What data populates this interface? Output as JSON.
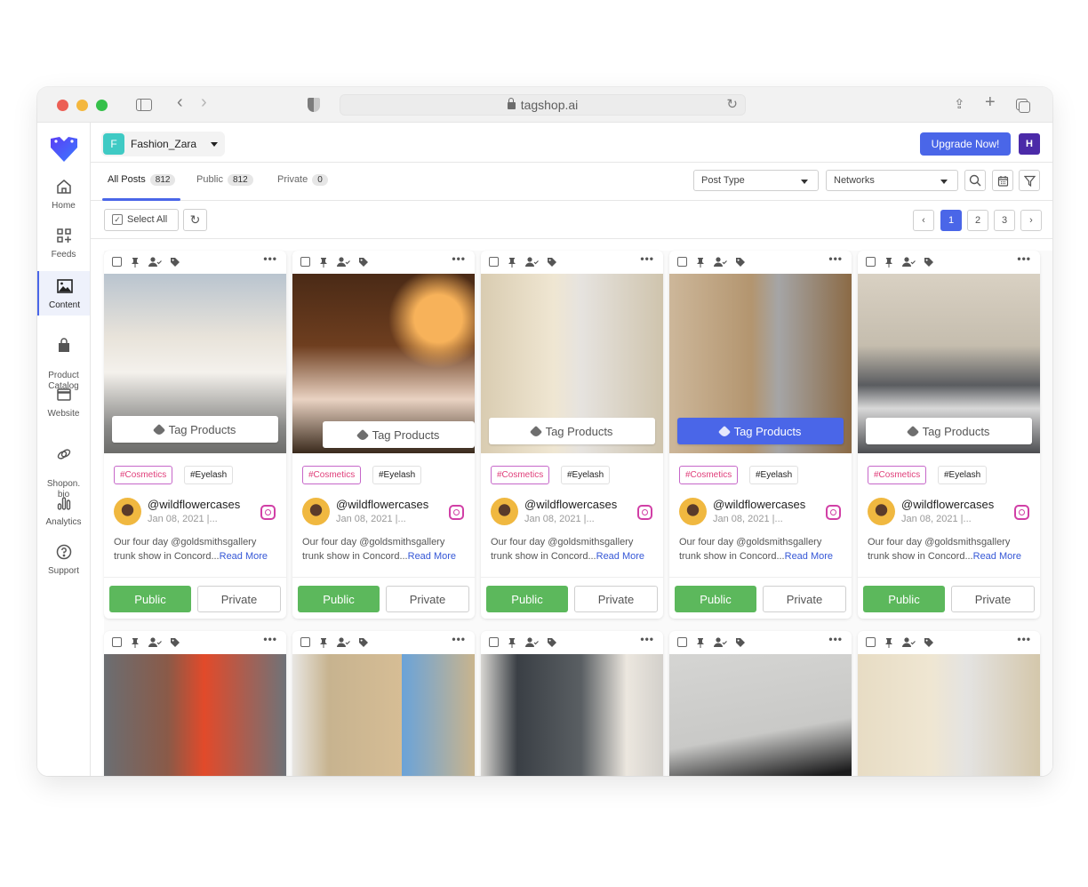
{
  "browser": {
    "url": "tagshop.ai"
  },
  "workspace": {
    "initial": "F",
    "name": "Fashion_Zara"
  },
  "header": {
    "upgrade_label": "Upgrade Now!",
    "user_initial": "H"
  },
  "sidebar": {
    "items": [
      {
        "label": "Home",
        "icon": "home-icon"
      },
      {
        "label": "Feeds",
        "icon": "feeds-icon"
      },
      {
        "label": "Content",
        "icon": "image-icon",
        "active": true
      },
      {
        "label": "Product\nCatalog",
        "icon": "bag-icon"
      },
      {
        "label": "Website",
        "icon": "browser-window-icon"
      },
      {
        "label": "Shopon.\nbio",
        "icon": "link-icon"
      },
      {
        "label": "Analytics",
        "icon": "bar-chart-icon"
      },
      {
        "label": "Support",
        "icon": "question-circle-icon"
      }
    ]
  },
  "tabs": [
    {
      "label": "All Posts",
      "count": "812",
      "active": true
    },
    {
      "label": "Public",
      "count": "812"
    },
    {
      "label": "Private",
      "count": "0"
    }
  ],
  "filters": {
    "post_type": "Post Type",
    "networks": "Networks"
  },
  "toolbar": {
    "select_all": "Select All"
  },
  "pagination": {
    "pages": [
      "1",
      "2",
      "3"
    ],
    "current": "1"
  },
  "card_common": {
    "tag_products": "Tag Products",
    "public": "Public",
    "private": "Private",
    "read_more": "Read More"
  },
  "posts": [
    {
      "hashtags": [
        "#Cosmetics",
        "#Eyelash"
      ],
      "username": "@wildflowercases",
      "date": "Jan 08, 2021 |...",
      "caption": "Our four day @goldsmithsgallery trunk show in Concord...",
      "network": "instagram"
    },
    {
      "hashtags": [
        "#Cosmetics",
        "#Eyelash"
      ],
      "username": "@wildflowercases",
      "date": "Jan 08, 2021 |...",
      "caption": "Our four day @goldsmithsgallery trunk show in Concord...",
      "network": "instagram"
    },
    {
      "hashtags": [
        "#Cosmetics",
        "#Eyelash"
      ],
      "username": "@wildflowercases",
      "date": "Jan 08, 2021 |...",
      "caption": "Our four day @goldsmithsgallery trunk show in Concord...",
      "network": "instagram"
    },
    {
      "hashtags": [
        "#Cosmetics",
        "#Eyelash"
      ],
      "username": "@wildflowercases",
      "date": "Jan 08, 2021 |...",
      "caption": "Our four day @goldsmithsgallery trunk show in Concord...",
      "network": "instagram",
      "tag_highlighted": true
    },
    {
      "hashtags": [
        "#Cosmetics",
        "#Eyelash"
      ],
      "username": "@wildflowercases",
      "date": "Jan 08, 2021 |...",
      "caption": "Our four day @goldsmithsgallery trunk show in Concord...",
      "network": "instagram"
    }
  ],
  "colors": {
    "accent": "#4a66e8",
    "public_green": "#5cb85c",
    "user_avatar": "#4b2aa8",
    "workspace_avatar": "#3fcac4"
  }
}
